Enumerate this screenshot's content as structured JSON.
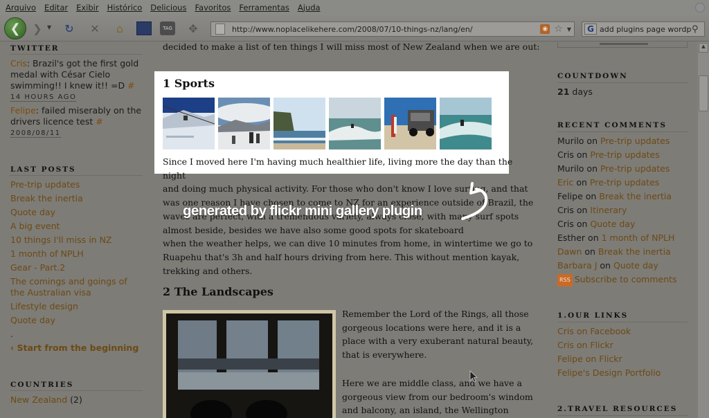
{
  "menu": [
    "Arquivo",
    "Editar",
    "Exibir",
    "Histórico",
    "Delicious",
    "Favoritos",
    "Ferramentas",
    "Ajuda"
  ],
  "toolbar": {
    "url": "http://www.noplacelikehere.com/2008/07/10-things-nz/lang/en/",
    "search_value": "add plugins page wordpress",
    "search_engine_icon": "G",
    "tag_label": "TAG"
  },
  "sidebar": {
    "twitter_title": "TWITTER",
    "tweets": [
      {
        "author": "Cris",
        "text": ": Brazil's got the first gold medal with César Cielo swimming!! I knew it!! =D ",
        "hash": "#",
        "time": "14 HOURS AGO"
      },
      {
        "author": "Felipe",
        "text": ": failed miserably on the drivers licence test ",
        "hash": "#",
        "time": "2008/08/11"
      }
    ],
    "last_posts_title": "LAST POSTS",
    "posts": [
      "Pre-trip updates",
      "Break the inertia",
      "Quote day",
      "A big event",
      "10 things I'll miss in NZ",
      "1 month of NPLH",
      "Gear - Part.2",
      "The comings and goings of the Australian visa",
      "Lifestyle design",
      "Quote day"
    ],
    "dot": ".",
    "start_link": "‹ Start from the beginning",
    "countries_title": "COUNTRIES",
    "country": "New Zealand",
    "country_count": "(2)"
  },
  "article": {
    "intro": "decided to make a list of ten things I will miss most of New Zealand when we are out:",
    "h1": "1 Sports",
    "p1": [
      "Since I moved here I'm having much healthier life, living more the day than the night",
      "and doing much physical activity. For those who don't know I love surfing, and that",
      "was one reason I have chosen to come to  NZ for an experience outside of Brazil, the",
      "waves are perfect, with a tremendous variety, always close, with many surf spots",
      "almost beside, besides we have also some good spots for skateboard",
      "when the weather helps, we can dive 10 minutes from home, in wintertime we go to",
      "Ruapehu that's 3h and half hours driving from here. This without mention kayak,",
      "trekking and others."
    ],
    "h2": "2 The Landscapes",
    "p2": [
      "Remember the Lord of the Rings, all those",
      "gorgeous locations were here, and it is a",
      "place with a very exuberant natural beauty,",
      "that is everywhere."
    ],
    "p3": [
      "Here we are middle class, and we have a",
      "gorgeous view from our bedroom's windom",
      "and balcony, an island, the Wellington"
    ]
  },
  "overlay": {
    "text": "generated by flickr mini gallery plugin"
  },
  "right": {
    "countdown_title": "COUNTDOWN",
    "countdown_value": "21",
    "countdown_unit": " days",
    "comments_title": "RECENT COMMENTS",
    "comments": [
      {
        "author": "Murilo",
        "post": "Pre-trip updates",
        "author_link": false
      },
      {
        "author": "Cris",
        "post": "Pre-trip updates",
        "author_link": false
      },
      {
        "author": "Murilo",
        "post": "Pre-trip updates",
        "author_link": false
      },
      {
        "author": "Eric",
        "post": "Pre-trip updates",
        "author_link": true
      },
      {
        "author": "Felipe",
        "post": "Break the inertia",
        "author_link": false
      },
      {
        "author": "Cris",
        "post": "Itinerary",
        "author_link": false
      },
      {
        "author": "Cris",
        "post": "Quote day",
        "author_link": false
      },
      {
        "author": "Esther",
        "post": "1 month of NPLH",
        "author_link": false
      },
      {
        "author": "Dawn",
        "post": "Break the inertia",
        "author_link": true
      },
      {
        "author": "Barbara J",
        "post": "Quote day",
        "author_link": true
      }
    ],
    "on": " on ",
    "rss_badge": "RSS",
    "subscribe": "Subscribe to comments",
    "links_title": "1.OUR LINKS",
    "links": [
      "Cris on Facebook",
      "Cris on Flickr",
      "Felipe on Flickr",
      "Felipe's Design Portfolio"
    ],
    "travel_title": "2.TRAVEL RESOURCES"
  }
}
